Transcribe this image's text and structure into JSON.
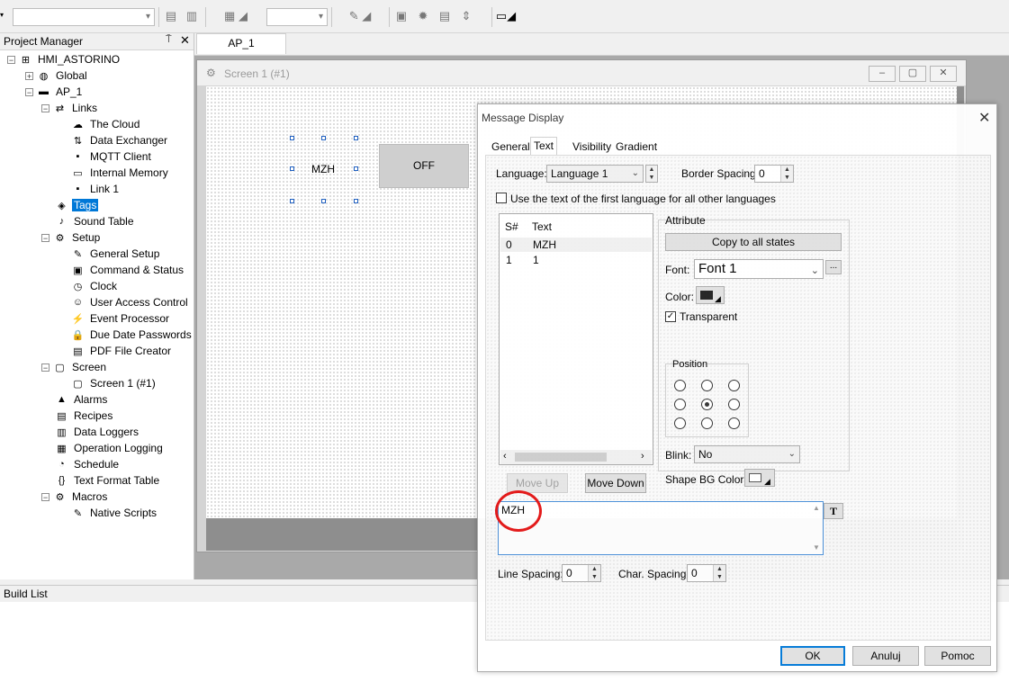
{
  "toolbar": {
    "combo1_value": "",
    "combo2_value": ""
  },
  "project_manager": {
    "title": "Project Manager",
    "pin": "⍑",
    "close": "✕",
    "items": [
      {
        "label": "HMI_ASTORINO",
        "expander": "−",
        "icon": "network-icon"
      },
      {
        "label": "Global",
        "expander": "+",
        "icon": "globe-icon"
      },
      {
        "label": "AP_1",
        "expander": "−",
        "icon": "monitor-icon"
      },
      {
        "label": "Links",
        "expander": "−",
        "icon": "links-icon"
      },
      {
        "label": "The Cloud",
        "expander": "",
        "icon": "cloud-icon"
      },
      {
        "label": "Data Exchanger",
        "expander": "",
        "icon": "exchange-icon"
      },
      {
        "label": "MQTT Client",
        "expander": "",
        "icon": "mqtt-icon"
      },
      {
        "label": "Internal Memory",
        "expander": "",
        "icon": "memory-icon"
      },
      {
        "label": "Link 1",
        "expander": "",
        "icon": "link-icon"
      },
      {
        "label": "Tags",
        "expander": "",
        "icon": "tags-icon"
      },
      {
        "label": "Sound Table",
        "expander": "",
        "icon": "sound-icon"
      },
      {
        "label": "Setup",
        "expander": "−",
        "icon": "setup-icon"
      },
      {
        "label": "General Setup",
        "expander": "",
        "icon": "general-setup-icon"
      },
      {
        "label": "Command & Status",
        "expander": "",
        "icon": "command-icon"
      },
      {
        "label": "Clock",
        "expander": "",
        "icon": "clock-icon"
      },
      {
        "label": "User Access Control",
        "expander": "",
        "icon": "user-icon"
      },
      {
        "label": "Event Processor",
        "expander": "",
        "icon": "lightning-icon"
      },
      {
        "label": "Due Date Passwords",
        "expander": "",
        "icon": "lock-icon"
      },
      {
        "label": "PDF File Creator",
        "expander": "",
        "icon": "pdf-icon"
      },
      {
        "label": "Screen",
        "expander": "−",
        "icon": "screen-icon"
      },
      {
        "label": "Screen 1 (#1)",
        "expander": "",
        "icon": "screen-page-icon"
      },
      {
        "label": "Alarms",
        "expander": "",
        "icon": "alarm-icon"
      },
      {
        "label": "Recipes",
        "expander": "",
        "icon": "recipe-icon"
      },
      {
        "label": "Data Loggers",
        "expander": "",
        "icon": "logger-icon"
      },
      {
        "label": "Operation Logging",
        "expander": "",
        "icon": "oplog-icon"
      },
      {
        "label": "Schedule",
        "expander": "",
        "icon": "schedule-icon"
      },
      {
        "label": "Text Format Table",
        "expander": "",
        "icon": "text-format-icon"
      },
      {
        "label": "Macros",
        "expander": "−",
        "icon": "macro-icon"
      },
      {
        "label": "Native Scripts",
        "expander": "",
        "icon": "script-icon"
      }
    ]
  },
  "editor": {
    "tab_label": "AP_1",
    "screen_title": "Screen 1 (#1)",
    "min": "–",
    "max": "▢",
    "close": "✕",
    "mzh_label": "MZH",
    "off_label": "OFF"
  },
  "build_list": {
    "title": "Build List"
  },
  "dialog": {
    "title": "Message Display",
    "close": "✕",
    "tabs": [
      "General",
      "Text",
      "Visibility",
      "Gradient"
    ],
    "language_label": "Language:",
    "language_value": "Language 1",
    "border_spacing_label": "Border Spacing:",
    "border_spacing_value": "0",
    "use_first_language_label": "Use the text of the first language for all other languages",
    "list_header_state": "S#",
    "list_header_text": "Text",
    "list_rows": [
      {
        "state": "0",
        "text": "MZH"
      },
      {
        "state": "1",
        "text": "1"
      }
    ],
    "move_up": "Move Up",
    "move_down": "Move Down",
    "attribute_label": "Attribute",
    "copy_all_states": "Copy to all states",
    "font_label": "Font:",
    "font_value": "Font 1",
    "font_more": "...",
    "color_label": "Color:",
    "transparent_label": "Transparent",
    "transparent_checked": "✓",
    "position_label": "Position",
    "blink_label": "Blink:",
    "blink_value": "No",
    "shape_bg_label": "Shape BG Color:",
    "text_value": "MZH",
    "text_button": "T",
    "line_spacing_label": "Line Spacing:",
    "line_spacing_value": "0",
    "char_spacing_label": "Char. Spacing:",
    "char_spacing_value": "0",
    "ok": "OK",
    "cancel": "Anuluj",
    "help": "Pomoc"
  }
}
